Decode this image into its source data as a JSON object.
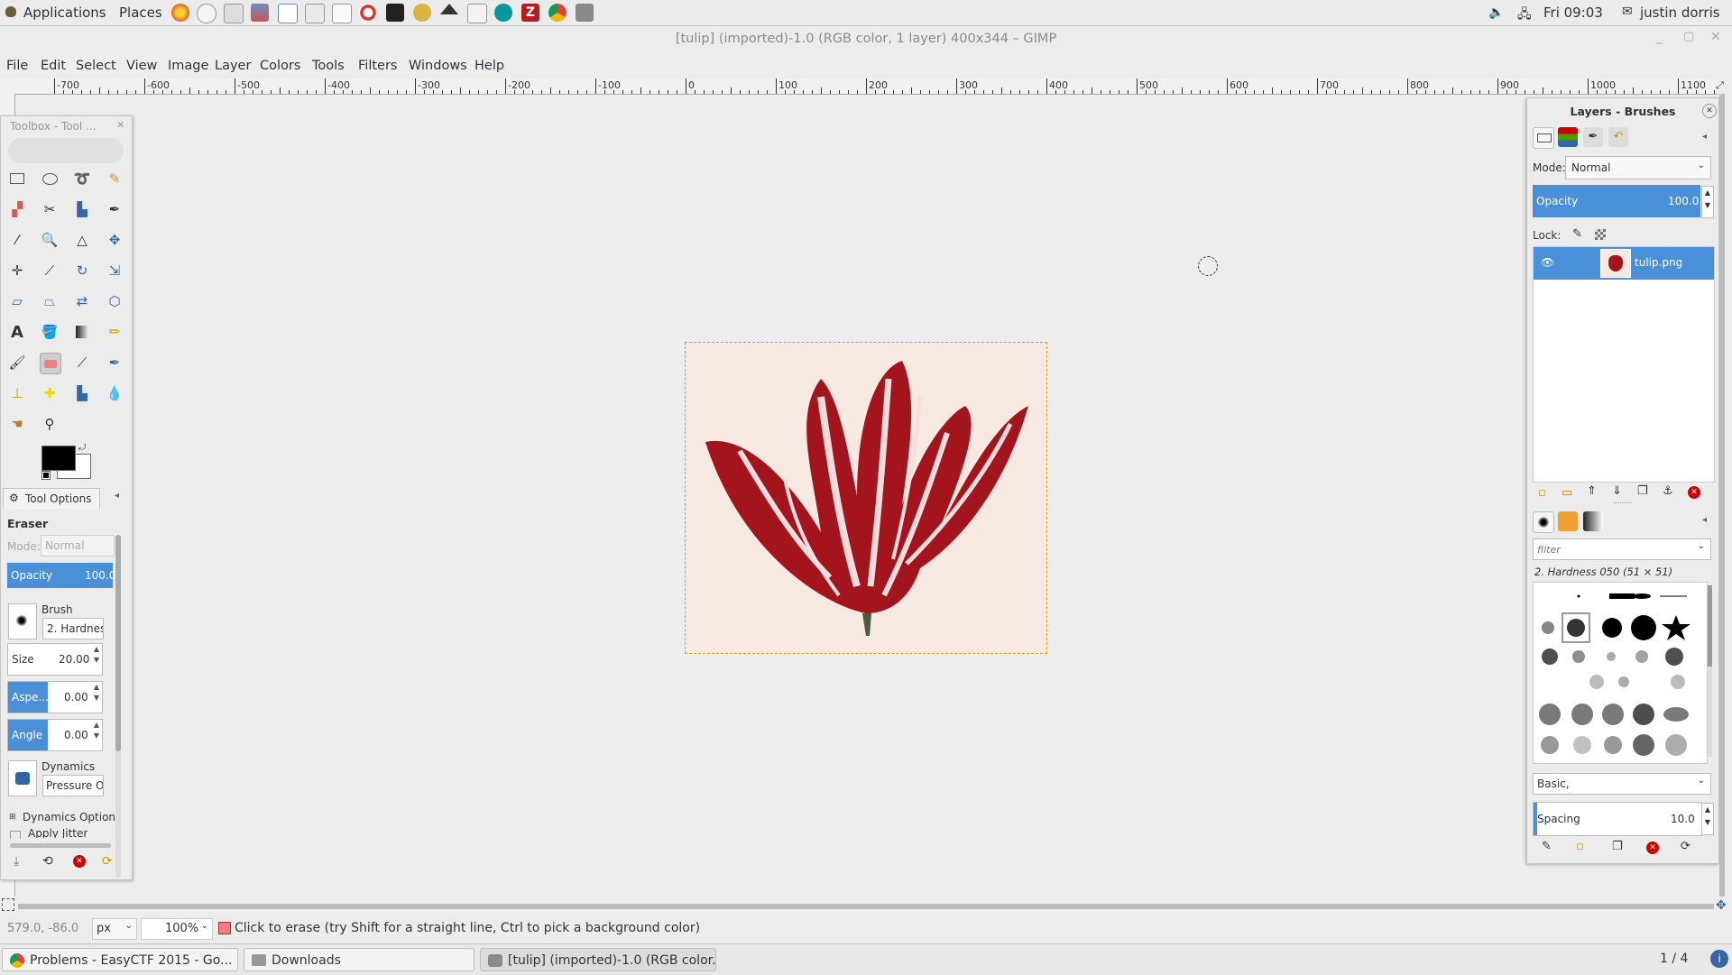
{
  "top_panel": {
    "applications": "Applications",
    "places": "Places",
    "clock": "Fri 09:03",
    "user": "justin dorris",
    "volume_icon": "speaker-icon",
    "network_icon": "network-icon"
  },
  "window": {
    "title": "[tulip] (imported)-1.0 (RGB color, 1 layer) 400x344 – GIMP"
  },
  "menu": [
    "File",
    "Edit",
    "Select",
    "View",
    "Image",
    "Layer",
    "Colors",
    "Tools",
    "Filters",
    "Windows",
    "Help"
  ],
  "ruler": {
    "labels": [
      "-700",
      "-600",
      "-500",
      "-400",
      "-300",
      "-200",
      "-100",
      "0",
      "100",
      "200",
      "300",
      "400",
      "500",
      "600",
      "700",
      "800",
      "900",
      "1000",
      "1100"
    ]
  },
  "toolbox": {
    "title": "Toolbox - Tool ...",
    "tool_options_tab": "Tool Options",
    "tool_name": "Eraser",
    "mode_label": "Mode:",
    "mode_value": "Normal",
    "opacity_label": "Opacity",
    "opacity_value": "100.0",
    "brush_label": "Brush",
    "brush_value": "2. Hardnes",
    "size_label": "Size",
    "size_value": "20.00",
    "aspect_label": "Aspe...",
    "aspect_value": "0.00",
    "angle_label": "Angle",
    "angle_value": "0.00",
    "dynamics_label": "Dynamics",
    "dynamics_value": "Pressure O",
    "dynamics_options": "Dynamics Options",
    "apply_jitter": "Apply Jitter",
    "fg_color": "#000000",
    "bg_color": "#ffffff"
  },
  "layers_dock": {
    "title": "Layers - Brushes",
    "mode_label": "Mode:",
    "mode_value": "Normal",
    "opacity_label": "Opacity",
    "opacity_value": "100.0",
    "lock_label": "Lock:",
    "layer_name": "tulip.png",
    "brushes_filter_placeholder": "filter",
    "brush_name": "2. Hardness 050 (51 × 51)",
    "brush_tags": "Basic,",
    "spacing_label": "Spacing",
    "spacing_value": "10.0"
  },
  "statusbar": {
    "coords": "579.0, -86.0",
    "unit": "px",
    "zoom": "100%",
    "message": "Click to erase (try Shift for a straight line, Ctrl to pick a background color)"
  },
  "taskbar": {
    "tasks": [
      "Problems - EasyCTF 2015 - Go...",
      "Downloads",
      "[tulip] (imported)-1.0 (RGB color..."
    ],
    "workspace": "1 / 4"
  },
  "colors": {
    "accent": "#4a90d9",
    "tulip_red": "#a3141c",
    "image_bg": "#f8e8e2"
  }
}
